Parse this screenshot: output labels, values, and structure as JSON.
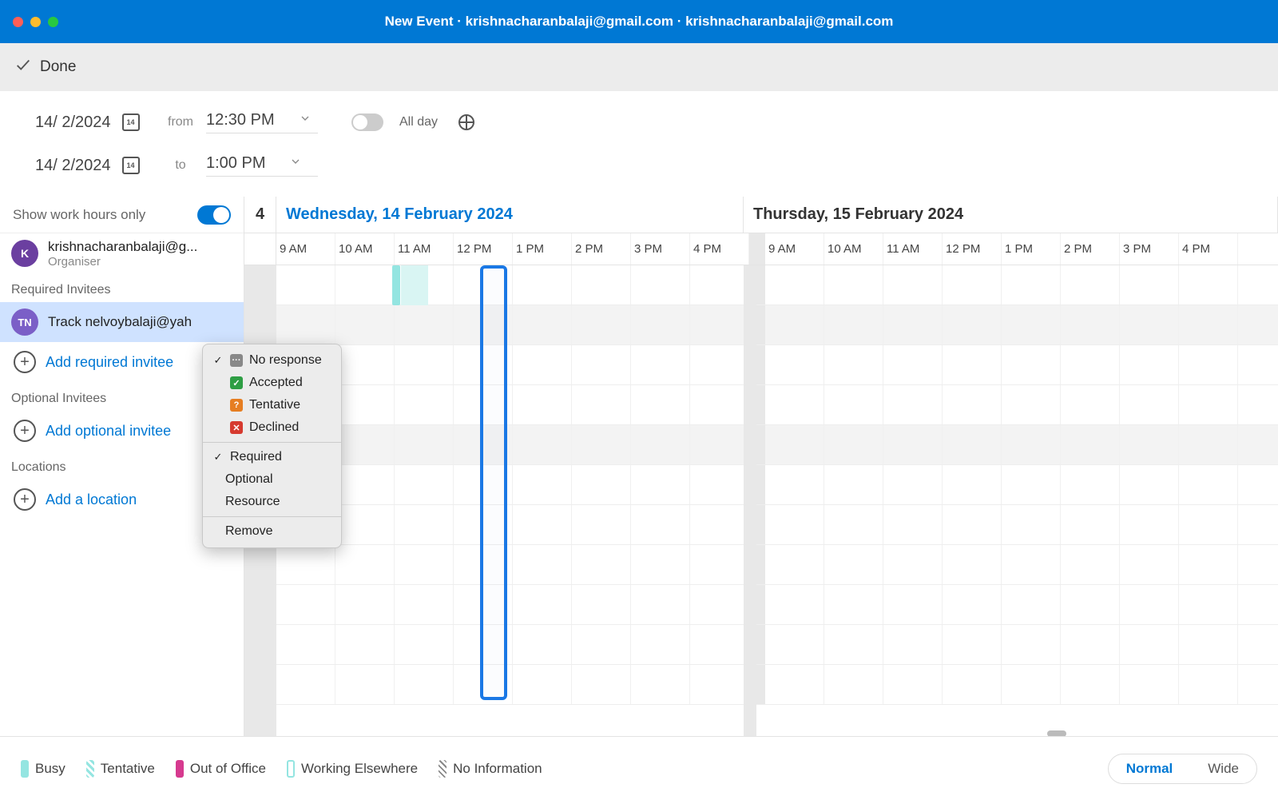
{
  "title": "New Event · krishnacharanbalaji@gmail.com · krishnacharanbalaji@gmail.com",
  "toolbar": {
    "done": "Done"
  },
  "datetime": {
    "from_date": "14/ 2/2024",
    "from_day_badge": "14",
    "from_label": "from",
    "from_time": "12:30 PM",
    "to_date": "14/ 2/2024",
    "to_day_badge": "14",
    "to_label": "to",
    "to_time": "1:00 PM",
    "all_day": "All day"
  },
  "sidebar": {
    "work_hours_label": "Show work hours only",
    "organiser": {
      "initial": "K",
      "email": "krishnacharanbalaji@g...",
      "role": "Organiser"
    },
    "required_section": "Required Invitees",
    "required_invitee": {
      "initials": "TN",
      "name": "Track nelvoybalaji@yah"
    },
    "add_required": "Add required invitee",
    "optional_section": "Optional Invitees",
    "add_optional": "Add optional invitee",
    "locations_section": "Locations",
    "add_location": "Add a location"
  },
  "calendar": {
    "prev_day_stub": "4",
    "day1": "Wednesday, 14 February 2024",
    "day2": "Thursday, 15 February 2024",
    "hours": [
      "9 AM",
      "10 AM",
      "11 AM",
      "12 PM",
      "1 PM",
      "2 PM",
      "3 PM",
      "4 PM",
      "9 AM",
      "10 AM",
      "11 AM",
      "12 PM",
      "1 PM",
      "2 PM",
      "3 PM",
      "4 PM"
    ]
  },
  "context_menu": {
    "no_response": "No response",
    "accepted": "Accepted",
    "tentative": "Tentative",
    "declined": "Declined",
    "required": "Required",
    "optional": "Optional",
    "resource": "Resource",
    "remove": "Remove"
  },
  "legend": {
    "busy": "Busy",
    "tentative": "Tentative",
    "ooo": "Out of Office",
    "we": "Working Elsewhere",
    "noinfo": "No Information"
  },
  "view": {
    "normal": "Normal",
    "wide": "Wide"
  }
}
